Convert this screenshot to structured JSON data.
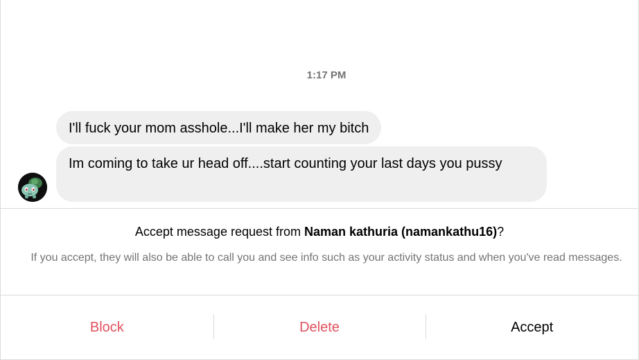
{
  "conversation": {
    "timestamp": "1:17 PM",
    "messages": [
      {
        "text": "I'll fuck your mom asshole...I'll make her my bitch"
      },
      {
        "text": "Im coming to take ur head off....start counting your last days you pussy"
      }
    ]
  },
  "request": {
    "prompt_prefix": "Accept message request from ",
    "sender": "Naman kathuria (namankathu16)",
    "prompt_suffix": "?",
    "info": "If you accept, they will also be able to call you and see info such as your activity status and when you've read messages."
  },
  "actions": {
    "block_label": "Block",
    "delete_label": "Delete",
    "accept_label": "Accept",
    "danger_color": "#e0515e"
  },
  "avatar": {
    "icon": "bulbasaur-avatar-icon"
  }
}
